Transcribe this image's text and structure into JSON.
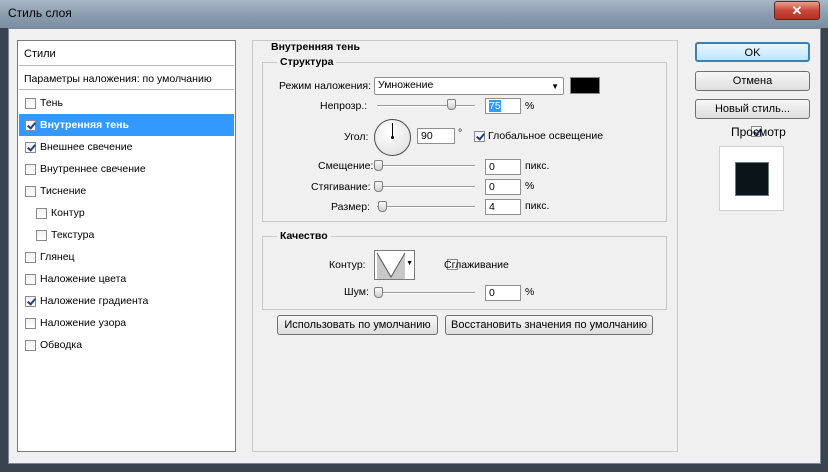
{
  "window": {
    "title": "Стиль слоя",
    "close": "✕"
  },
  "left": {
    "header": "Стили",
    "blend_defaults": "Параметры наложения: по умолчанию",
    "items": [
      {
        "label": "Тень",
        "checked": false,
        "indent": false
      },
      {
        "label": "Внутренняя тень",
        "checked": true,
        "indent": false,
        "selected": true
      },
      {
        "label": "Внешнее свечение",
        "checked": true,
        "indent": false
      },
      {
        "label": "Внутреннее свечение",
        "checked": false,
        "indent": false
      },
      {
        "label": "Тиснение",
        "checked": false,
        "indent": false
      },
      {
        "label": "Контур",
        "checked": false,
        "indent": true
      },
      {
        "label": "Текстура",
        "checked": false,
        "indent": true
      },
      {
        "label": "Глянец",
        "checked": false,
        "indent": false
      },
      {
        "label": "Наложение цвета",
        "checked": false,
        "indent": false
      },
      {
        "label": "Наложение градиента",
        "checked": true,
        "indent": false
      },
      {
        "label": "Наложение узора",
        "checked": false,
        "indent": false
      },
      {
        "label": "Обводка",
        "checked": false,
        "indent": false
      }
    ]
  },
  "panel": {
    "title": "Внутренняя тень",
    "structure": {
      "title": "Структура",
      "blend_label": "Режим наложения:",
      "blend_value": "Умножение",
      "color": "#000000",
      "opacity_label": "Непрозр.:",
      "opacity_value": "75",
      "opacity_unit": "%",
      "opacity_level": 0.75,
      "angle_label": "Угол:",
      "angle_value": "90",
      "angle_unit": "°",
      "global_light": "Глобальное освещение",
      "global_light_checked": true,
      "distance_label": "Смещение:",
      "distance_value": "0",
      "distance_unit": "пикс.",
      "choke_label": "Стягивание:",
      "choke_value": "0",
      "choke_unit": "%",
      "size_label": "Размер:",
      "size_value": "4",
      "size_unit": "пикс."
    },
    "quality": {
      "title": "Качество",
      "contour_label": "Контур:",
      "antialias": "Сглаживание",
      "antialias_checked": false,
      "noise_label": "Шум:",
      "noise_value": "0",
      "noise_unit": "%"
    },
    "make_default": "Использовать по умолчанию",
    "reset_default": "Восстановить значения по умолчанию"
  },
  "right": {
    "ok": "OK",
    "cancel": "Отмена",
    "new_style": "Новый стиль...",
    "preview": "Просмотр",
    "preview_checked": true
  }
}
